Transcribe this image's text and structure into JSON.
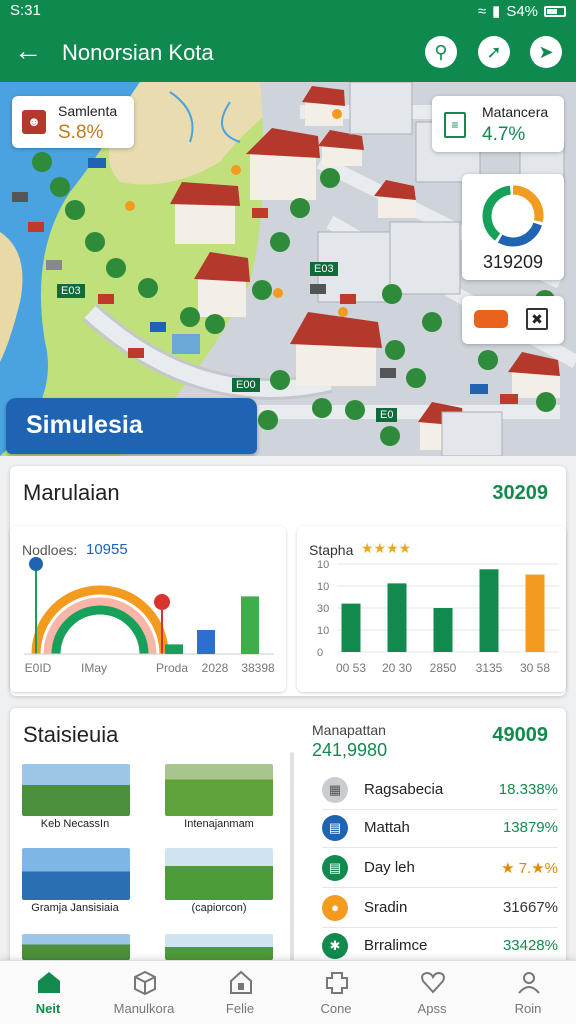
{
  "status": {
    "time": "S:31",
    "battery": "S4%"
  },
  "appbar": {
    "back_icon": "arrow-left-icon",
    "title": "Nonorsian Kota",
    "actions": [
      "search-icon",
      "compass-icon",
      "location-icon"
    ]
  },
  "map": {
    "card_left": {
      "label": "Samlenta",
      "value": "S.8%",
      "value_color": "#c07a1a"
    },
    "card_right": {
      "label": "Matancera",
      "value": "4.7%",
      "value_color": "#128a4e"
    },
    "donut": {
      "value": "319209",
      "segments": [
        {
          "fraction": 0.3,
          "color": "#f29b1e"
        },
        {
          "fraction": 0.3,
          "color": "#1f63b3"
        },
        {
          "fraction": 0.4,
          "color": "#17a05a"
        }
      ]
    },
    "vehicle_icons": [
      "car-icon",
      "bus-icon"
    ],
    "sign_labels": [
      "E03",
      "E03",
      "E00",
      "E0"
    ],
    "banner": "Simulesia"
  },
  "marulaian": {
    "title": "Marulaian",
    "value": "30209",
    "left_chart": {
      "label": "Nodloes:",
      "value": "10955",
      "x_labels": [
        "E0ID",
        "IMay",
        "Proda",
        "2028",
        "38398"
      ],
      "bars": [
        {
          "value": 0.12,
          "color": "#17a05a"
        },
        {
          "value": 0.3,
          "color": "#2e6ed0"
        },
        {
          "value": 0.72,
          "color": "#3fae49"
        }
      ]
    },
    "right_chart": {
      "label": "Stapha",
      "y_ticks": [
        "10",
        "10",
        "30",
        "10",
        "0"
      ],
      "x_labels": [
        "00 53",
        "20 30",
        "2850",
        "3135",
        "30 58"
      ],
      "bars": [
        {
          "value": 0.55,
          "color": "#128a4e"
        },
        {
          "value": 0.78,
          "color": "#128a4e"
        },
        {
          "value": 0.5,
          "color": "#128a4e"
        },
        {
          "value": 0.94,
          "color": "#128a4e"
        },
        {
          "value": 0.88,
          "color": "#f29b1e"
        }
      ]
    }
  },
  "statistics": {
    "title": "Staisieuia",
    "thumbnails": [
      {
        "caption": "Keb NecassIn",
        "icon": "people-photo-icon"
      },
      {
        "caption": "Intenajanmam",
        "icon": "dog-photo-icon"
      },
      {
        "caption": "Gramja Jansisiaia",
        "icon": "people-photo-icon"
      },
      {
        "caption": "(capiorcon)",
        "icon": "person-photo-icon"
      },
      {
        "caption": "",
        "icon": "people-photo-icon"
      },
      {
        "caption": "",
        "icon": "person-photo-icon"
      }
    ],
    "manapattan_label": "Manapattan",
    "manapattan_value": "241,9980",
    "manapattan_total": "49009",
    "rows": [
      {
        "icon": "grid-icon",
        "name": "Ragsabecia",
        "value": "18.338%",
        "value_color": "#128a4e",
        "icon_color": "#c9cdd2"
      },
      {
        "icon": "bus-icon",
        "name": "Mattah",
        "value": "13879%",
        "value_color": "#128a4e",
        "icon_color": "#1f63b3"
      },
      {
        "icon": "bus-icon",
        "name": "Day leh",
        "value": "★ 7.★%",
        "value_color": "#e08a00",
        "icon_color": "#128a4e"
      },
      {
        "icon": "coin-icon",
        "name": "Sradin",
        "value": "31667%",
        "value_color": "#333",
        "icon_color": "#f29b1e"
      },
      {
        "icon": "bug-icon",
        "name": "Brralimce",
        "value": "33428%",
        "value_color": "#128a4e",
        "icon_color": "#128a4e"
      }
    ]
  },
  "bottomnav": [
    {
      "label": "Neit",
      "icon": "home-icon",
      "active": true
    },
    {
      "label": "Manulkora",
      "icon": "box-icon",
      "active": false
    },
    {
      "label": "Felie",
      "icon": "lock-house-icon",
      "active": false
    },
    {
      "label": "Cone",
      "icon": "puzzle-icon",
      "active": false
    },
    {
      "label": "Apss",
      "icon": "heart-icon",
      "active": false
    },
    {
      "label": "Roin",
      "icon": "profile-icon",
      "active": false
    }
  ]
}
